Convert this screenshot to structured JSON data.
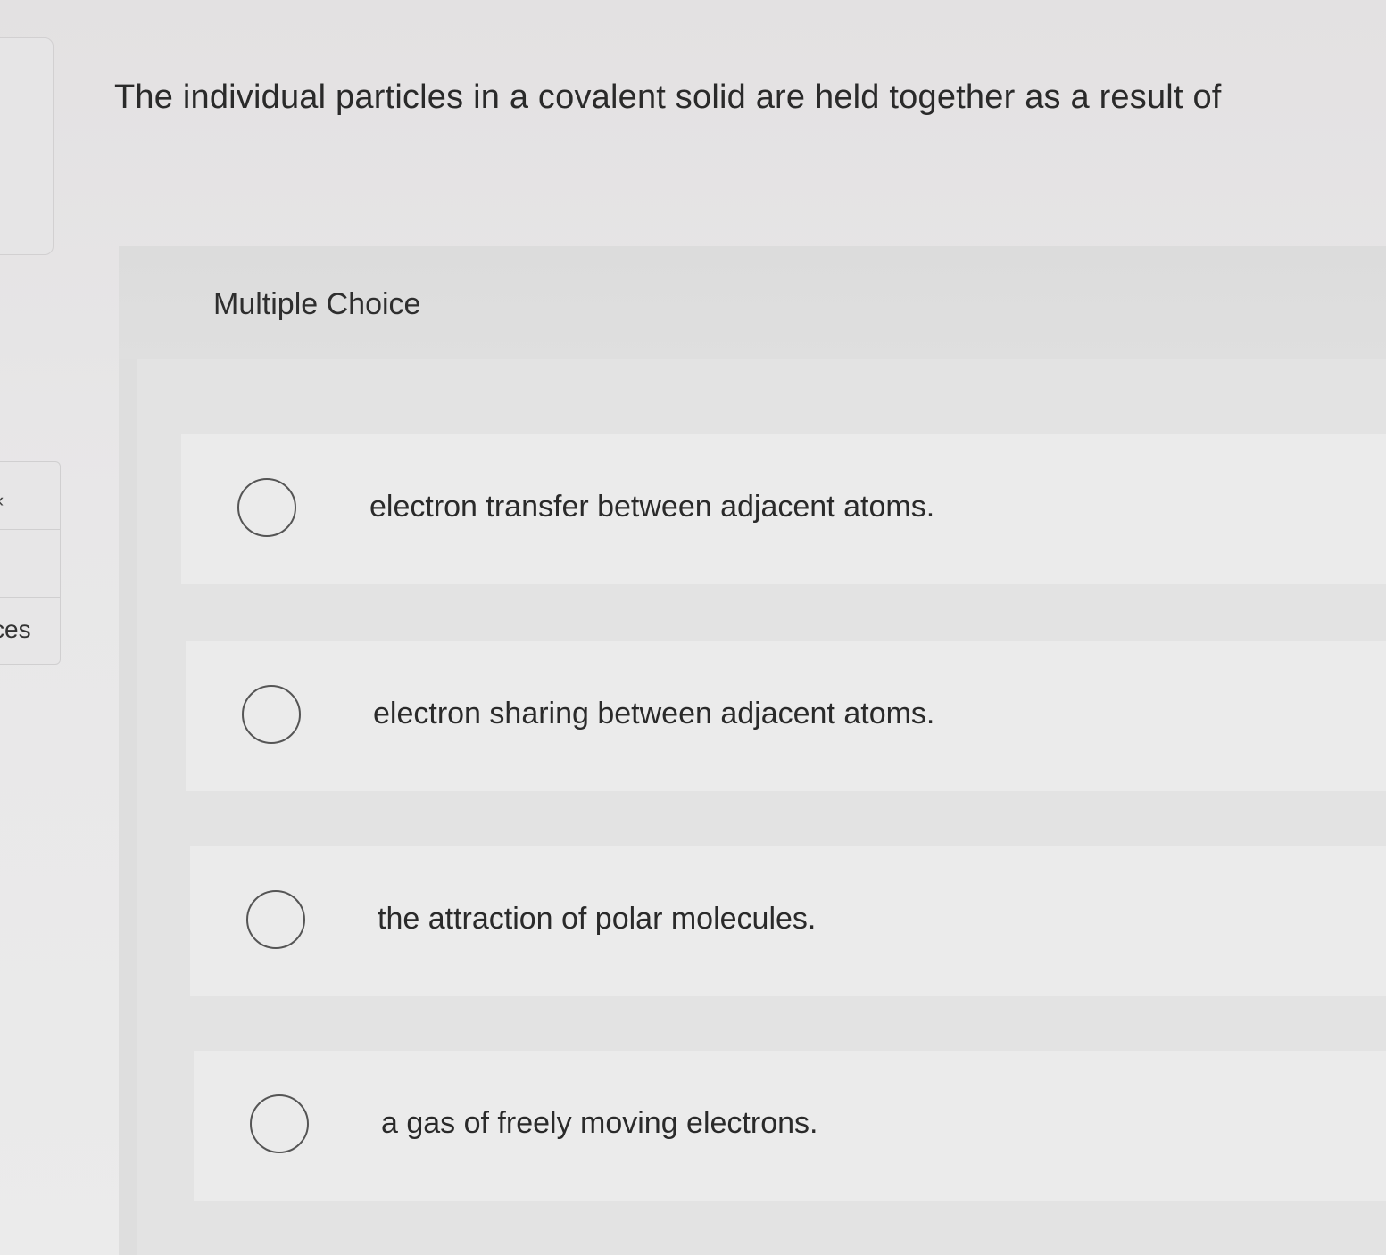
{
  "question": {
    "text": "The individual particles in a covalent solid are held together as a result of"
  },
  "left_nav": {
    "items": [
      {
        "label": "",
        "icon": "chevron-left-icon"
      },
      {
        "label": ""
      },
      {
        "label": "ces"
      }
    ]
  },
  "multiple_choice": {
    "title": "Multiple Choice",
    "options": [
      {
        "label": "electron transfer between adjacent atoms.",
        "selected": false
      },
      {
        "label": "electron sharing between adjacent atoms.",
        "selected": false
      },
      {
        "label": "the attraction of polar molecules.",
        "selected": false
      },
      {
        "label": "a gas of freely moving electrons.",
        "selected": false
      }
    ]
  }
}
